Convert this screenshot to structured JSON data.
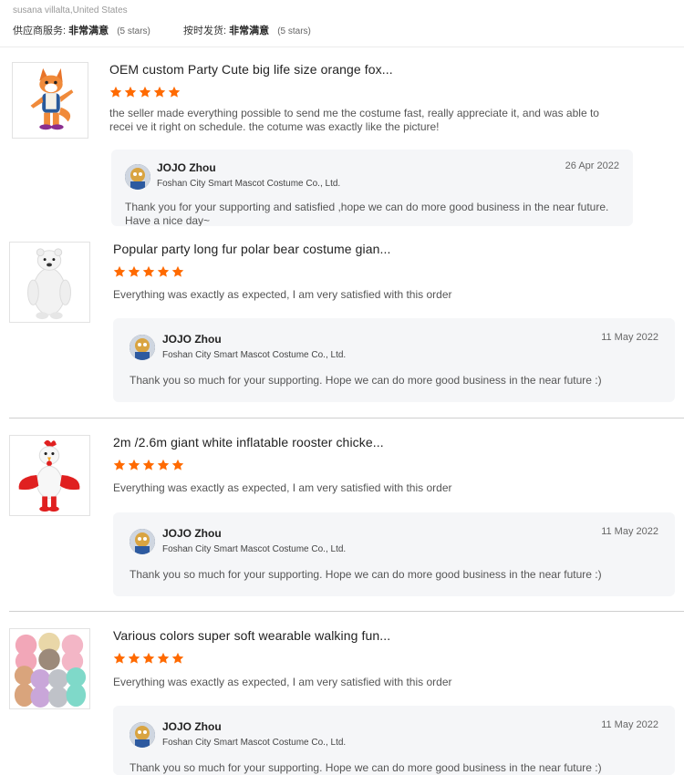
{
  "header": {
    "reviewer": "susana villalta,United States",
    "ratings": [
      {
        "label": "供应商服务:",
        "value": "非常满意",
        "stars": "(5 stars)"
      },
      {
        "label": "按时发货:",
        "value": "非常满意",
        "stars": "(5 stars)"
      }
    ]
  },
  "reviews": [
    {
      "product_title": "OEM custom Party Cute big life size orange fox...",
      "rating": 5,
      "comment": "the seller made everything possible to send me the costume fast, really appreciate it, and was able to recei ve it right on schedule. the cotume was exactly like the picture!",
      "reply": {
        "name": "JOJO Zhou",
        "company": "Foshan City Smart Mascot Costume Co., Ltd.",
        "date": "26 Apr 2022",
        "text": "Thank you for your supporting and satisfied ,hope we can do more good business in the near future. Have a nice day~"
      }
    },
    {
      "product_title": "Popular party long fur polar bear costume gian...",
      "rating": 5,
      "comment": "Everything was exactly as expected, I am very satisfied with this order",
      "reply": {
        "name": "JOJO Zhou",
        "company": "Foshan City Smart Mascot Costume Co., Ltd.",
        "date": "11 May 2022",
        "text": "Thank you so much for your supporting. Hope we can do more good business in the near future :)"
      }
    },
    {
      "product_title": "2m /2.6m giant white inflatable rooster chicke...",
      "rating": 5,
      "comment": "Everything was exactly as expected, I am very satisfied with this order",
      "reply": {
        "name": "JOJO Zhou",
        "company": "Foshan City Smart Mascot Costume Co., Ltd.",
        "date": "11 May 2022",
        "text": "Thank you so much for your supporting. Hope we can do more good business in the near future :)"
      }
    },
    {
      "product_title": "Various colors super soft wearable walking fun...",
      "rating": 5,
      "comment": "Everything was exactly as expected, I am very satisfied with this order",
      "reply": {
        "name": "JOJO Zhou",
        "company": "Foshan City Smart Mascot Costume Co., Ltd.",
        "date": "11 May 2022",
        "text": "Thank you so much for your supporting. Hope we can do more good business in the near future :)"
      }
    }
  ],
  "colors": {
    "star": "#ff6a00",
    "reply_bg": "#f5f6f8"
  }
}
